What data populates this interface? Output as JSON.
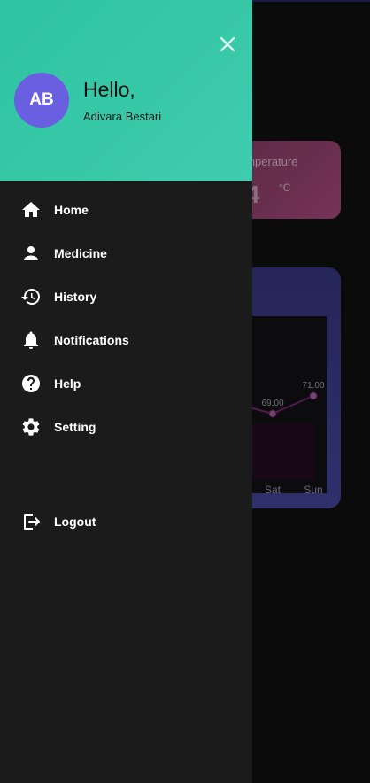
{
  "background": {
    "temperature_label": "emperature",
    "temperature_value": ".4",
    "temperature_unit": "°C",
    "chart": {
      "point_labels": [
        "69.00",
        "71.00"
      ],
      "x_labels": [
        "Sat",
        "Sun"
      ]
    }
  },
  "drawer": {
    "greeting": "Hello,",
    "user_name": "Adivara Bestari",
    "avatar_initials": "AB",
    "menu": [
      {
        "label": "Home",
        "icon": "home-icon"
      },
      {
        "label": "Medicine",
        "icon": "person-icon"
      },
      {
        "label": "History",
        "icon": "history-icon"
      },
      {
        "label": "Notifications",
        "icon": "bell-icon"
      },
      {
        "label": "Help",
        "icon": "help-icon"
      },
      {
        "label": "Setting",
        "icon": "gear-icon"
      }
    ],
    "logout_label": "Logout"
  },
  "colors": {
    "header_gradient": "#2fc3a2",
    "avatar": "#6a5fe0",
    "drawer_bg": "#1b1b1c",
    "temp_card": "#b44f86",
    "chart_card": "#4a4aa8"
  },
  "chart_data": {
    "type": "line",
    "categories": [
      "Sat",
      "Sun"
    ],
    "values": [
      69.0,
      71.0
    ],
    "title": "",
    "xlabel": "",
    "ylabel": ""
  }
}
